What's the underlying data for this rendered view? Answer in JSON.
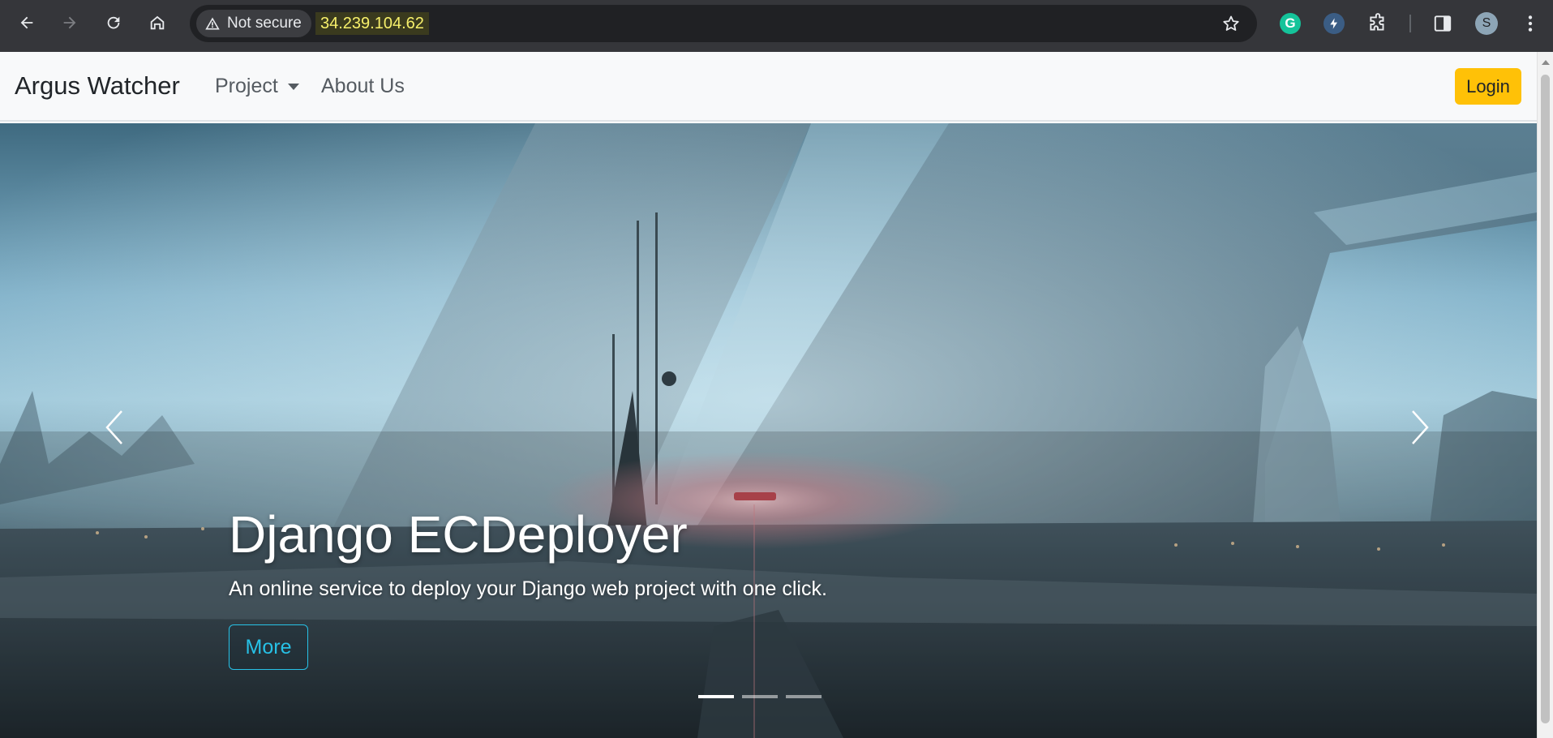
{
  "browser": {
    "security_label": "Not secure",
    "url": "34.239.104.62",
    "profile_initial": "S",
    "grammarly_letter": "G"
  },
  "navbar": {
    "brand": "Argus Watcher",
    "links": [
      {
        "label": "Project",
        "has_dropdown": true
      },
      {
        "label": "About Us",
        "has_dropdown": false
      }
    ],
    "login_label": "Login",
    "login_color": "#ffc107"
  },
  "carousel": {
    "active_slide": 1,
    "slide_count": 3,
    "caption": {
      "title": "Django ECDeployer",
      "text": "An online service to deploy your Django web project with one click.",
      "button_label": "More",
      "button_color": "#27c1e6"
    },
    "controls": {
      "prev_icon": "chevron-left-icon",
      "next_icon": "chevron-right-icon"
    }
  }
}
